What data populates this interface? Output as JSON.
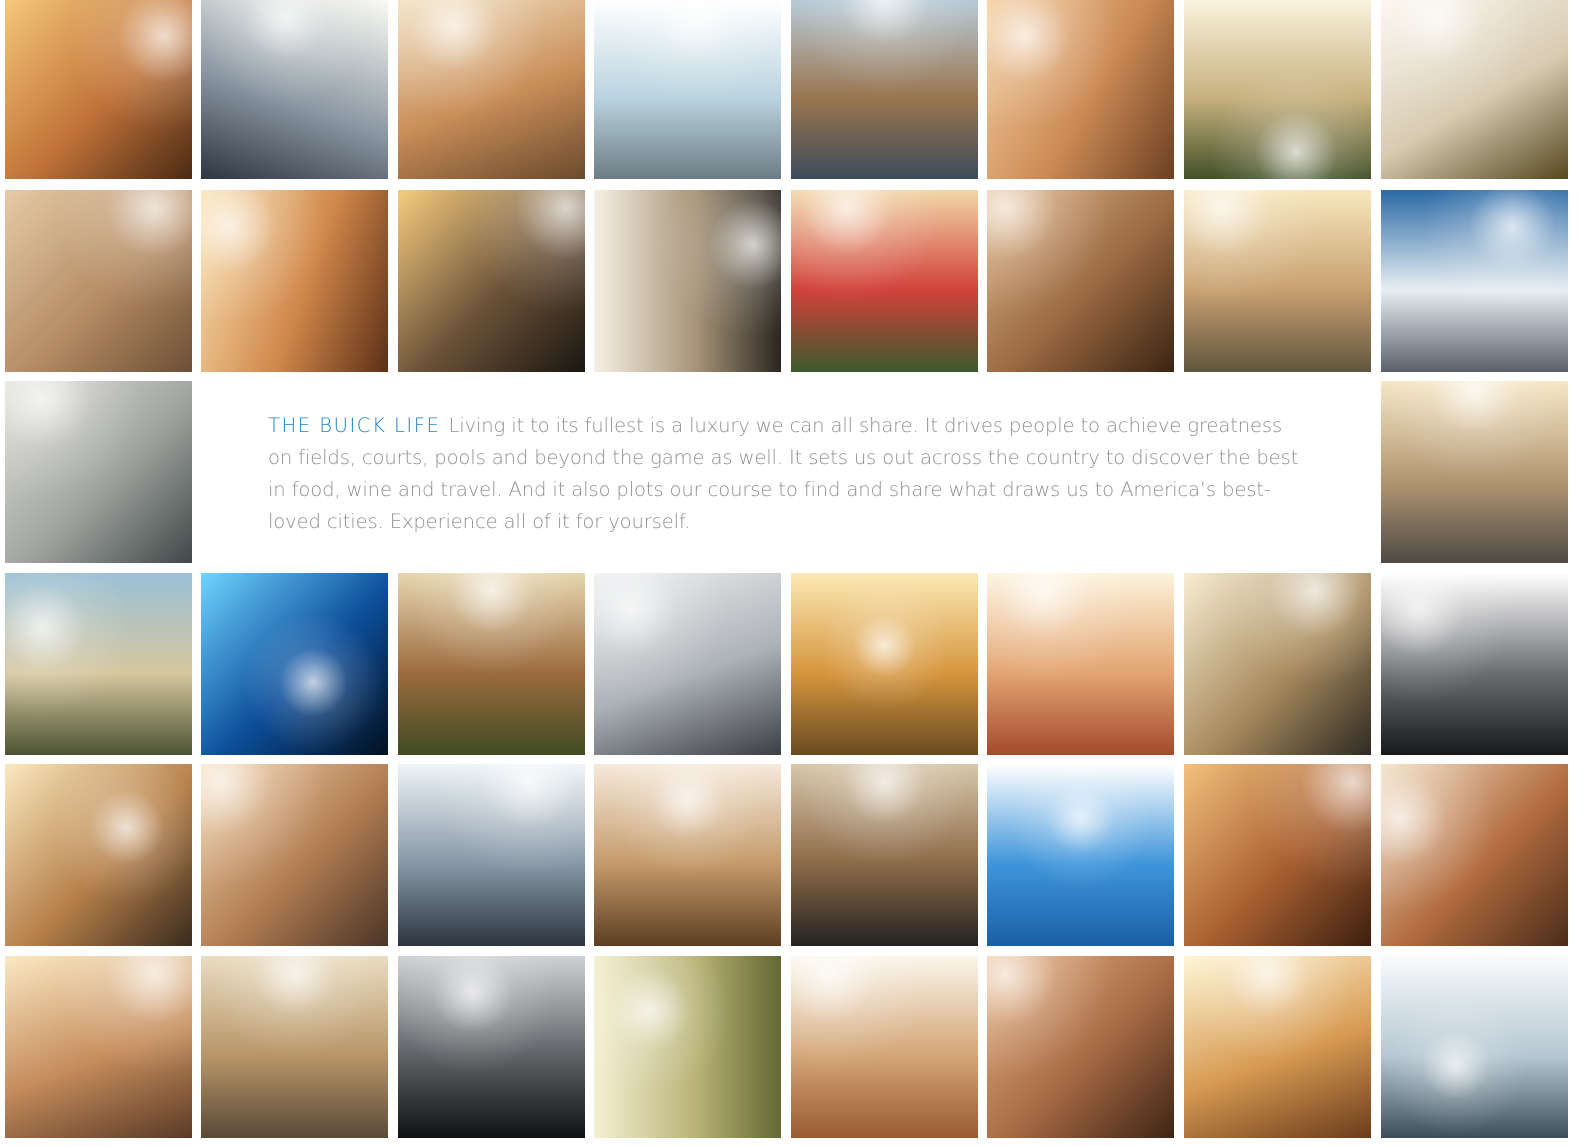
{
  "intro": {
    "heading": "THE BUICK LIFE",
    "body": "Living it to its fullest is a luxury we can all share. It drives people to achieve greatness on fields, courts, pools and beyond the game as well. It sets us out across the country to discover the best in food, wine and travel. And it also plots our course to find and share what draws us to America’s best-loved cities. Experience all of it for yourself.",
    "heading_color": "#1a83c6",
    "body_color": "#8f8f8f"
  },
  "photos": [
    {
      "name": "photo-woman-smiling-in-car",
      "row": 0,
      "col": 0,
      "colors": [
        "#f6c77a",
        "#c07238",
        "#4a2a14"
      ],
      "angle": 135,
      "sun": [
        0.85,
        0.2
      ]
    },
    {
      "name": "photo-car-trunk-sunburst",
      "row": 0,
      "col": 1,
      "colors": [
        "#fbfbf4",
        "#8c98a4",
        "#2d3640"
      ],
      "angle": 200,
      "sun": [
        0.45,
        0.1
      ]
    },
    {
      "name": "photo-couple-sitting-by-car",
      "row": 0,
      "col": 2,
      "colors": [
        "#f3e3c4",
        "#c98d58",
        "#6b4a2e"
      ],
      "angle": 160,
      "sun": [
        0.3,
        0.15
      ]
    },
    {
      "name": "photo-woman-walking-sunlight",
      "row": 0,
      "col": 3,
      "colors": [
        "#ffffff",
        "#b9d3df",
        "#6c7c84"
      ],
      "angle": 180,
      "sun": [
        0.55,
        0.1
      ]
    },
    {
      "name": "photo-city-skyline-waterfront",
      "row": 0,
      "col": 4,
      "colors": [
        "#b7cad8",
        "#9a7550",
        "#3d4b5c"
      ],
      "angle": 180,
      "sun": [
        0.5,
        0.0
      ]
    },
    {
      "name": "photo-woman-smiling-portrait",
      "row": 0,
      "col": 5,
      "colors": [
        "#f4d0a2",
        "#cc8a55",
        "#6b3f22"
      ],
      "angle": 120,
      "sun": [
        0.2,
        0.2
      ]
    },
    {
      "name": "photo-golfer-swinging",
      "row": 0,
      "col": 6,
      "colors": [
        "#fbf3dd",
        "#c7b07e",
        "#415028"
      ],
      "angle": 180,
      "sun": [
        0.6,
        0.85
      ]
    },
    {
      "name": "photo-plated-mussels-dish",
      "row": 0,
      "col": 7,
      "colors": [
        "#fbf7ef",
        "#d8cbb2",
        "#55481f"
      ],
      "angle": 150,
      "sun": [
        0.3,
        0.1
      ]
    },
    {
      "name": "photo-sandy-foot",
      "row": 1,
      "col": 0,
      "colors": [
        "#e5cba6",
        "#b58c65",
        "#6d4e35"
      ],
      "angle": 135,
      "sun": [
        0.8,
        0.1
      ]
    },
    {
      "name": "photo-woman-laughing-driving",
      "row": 1,
      "col": 1,
      "colors": [
        "#fbe4b4",
        "#d0874a",
        "#5c2f16"
      ],
      "angle": 110,
      "sun": [
        0.15,
        0.2
      ]
    },
    {
      "name": "photo-buick-grille-emblem",
      "row": 1,
      "col": 2,
      "colors": [
        "#f7cd7e",
        "#6b5238",
        "#1b1612"
      ],
      "angle": 135,
      "sun": [
        0.9,
        0.1
      ]
    },
    {
      "name": "photo-car-road-overhead",
      "row": 1,
      "col": 3,
      "colors": [
        "#f6f0e3",
        "#a69378",
        "#2a2620"
      ],
      "angle": 90,
      "sun": [
        0.85,
        0.3
      ]
    },
    {
      "name": "photo-girl-watermelon",
      "row": 1,
      "col": 4,
      "colors": [
        "#f2d7a8",
        "#d2413b",
        "#3b5a2c"
      ],
      "angle": 180,
      "sun": [
        0.3,
        0.1
      ]
    },
    {
      "name": "photo-man-smiling-portrait",
      "row": 1,
      "col": 5,
      "colors": [
        "#e2b98c",
        "#9a6841",
        "#3a2414"
      ],
      "angle": 135,
      "sun": [
        0.1,
        0.1
      ]
    },
    {
      "name": "photo-couple-walking-holding-hands",
      "row": 1,
      "col": 6,
      "colors": [
        "#f7e7bd",
        "#c8a070",
        "#61553e"
      ],
      "angle": 180,
      "sun": [
        0.2,
        0.1
      ]
    },
    {
      "name": "photo-snowy-mountains",
      "row": 1,
      "col": 7,
      "colors": [
        "#2b6aa6",
        "#e8eef2",
        "#5a606a"
      ],
      "angle": 180,
      "sun": [
        0.7,
        0.2
      ]
    },
    {
      "name": "photo-shadow-on-pebbles",
      "row": 2,
      "col": 0,
      "colors": [
        "#e2e1da",
        "#9fa39f",
        "#3f4848"
      ],
      "angle": 135,
      "sun": [
        0.2,
        0.1
      ]
    },
    {
      "name": "photo-car-mountain-road",
      "row": 2,
      "col": 7,
      "colors": [
        "#f6e7c6",
        "#b29672",
        "#4e4a44"
      ],
      "angle": 180,
      "sun": [
        0.5,
        0.05
      ]
    },
    {
      "name": "photo-coastal-cliffs",
      "row": 3,
      "col": 0,
      "colors": [
        "#9ac0d6",
        "#d6c79f",
        "#4c5332"
      ],
      "angle": 180,
      "sun": [
        0.2,
        0.3
      ]
    },
    {
      "name": "photo-blue-speedometer",
      "row": 3,
      "col": 1,
      "colors": [
        "#6fd4ff",
        "#0c4d9a",
        "#03101f"
      ],
      "angle": 135,
      "sun": [
        0.6,
        0.6
      ]
    },
    {
      "name": "photo-open-book-field",
      "row": 3,
      "col": 2,
      "colors": [
        "#e7d6b0",
        "#9c6b3e",
        "#3f4a22"
      ],
      "angle": 180,
      "sun": [
        0.5,
        0.1
      ]
    },
    {
      "name": "photo-silver-car-wheel",
      "row": 3,
      "col": 3,
      "colors": [
        "#f0f1f2",
        "#adb2b7",
        "#3b3f44"
      ],
      "angle": 160,
      "sun": [
        0.2,
        0.2
      ]
    },
    {
      "name": "photo-hikers-sunset",
      "row": 3,
      "col": 4,
      "colors": [
        "#fce9b6",
        "#d6963e",
        "#6a4a21"
      ],
      "angle": 180,
      "sun": [
        0.5,
        0.4
      ]
    },
    {
      "name": "photo-girl-eating-watermelon",
      "row": 3,
      "col": 5,
      "colors": [
        "#fdf3dc",
        "#e3a472",
        "#a44a2c"
      ],
      "angle": 180,
      "sun": [
        0.3,
        0.1
      ]
    },
    {
      "name": "photo-clothespins-line",
      "row": 3,
      "col": 6,
      "colors": [
        "#f8eed4",
        "#a88a5d",
        "#2e2a22"
      ],
      "angle": 135,
      "sun": [
        0.7,
        0.1
      ]
    },
    {
      "name": "photo-leather-seat",
      "row": 3,
      "col": 7,
      "colors": [
        "#ffffff",
        "#6b6d70",
        "#17181a"
      ],
      "angle": 180,
      "sun": [
        0.2,
        0.2
      ]
    },
    {
      "name": "photo-car-under-bridge",
      "row": 4,
      "col": 0,
      "colors": [
        "#fbe9bf",
        "#b6804a",
        "#3a2a1d"
      ],
      "angle": 135,
      "sun": [
        0.65,
        0.35
      ]
    },
    {
      "name": "photo-couple-in-car",
      "row": 4,
      "col": 1,
      "colors": [
        "#f4d9b3",
        "#b27c52",
        "#4a3526"
      ],
      "angle": 135,
      "sun": [
        0.1,
        0.1
      ]
    },
    {
      "name": "photo-car-wind-turbines",
      "row": 4,
      "col": 2,
      "colors": [
        "#eef4f8",
        "#8797a6",
        "#2c3540"
      ],
      "angle": 180,
      "sun": [
        0.7,
        0.1
      ]
    },
    {
      "name": "photo-winding-road",
      "row": 4,
      "col": 3,
      "colors": [
        "#f6eadb",
        "#c49a6a",
        "#5d3e22"
      ],
      "angle": 180,
      "sun": [
        0.5,
        0.2
      ]
    },
    {
      "name": "photo-car-dashboard",
      "row": 4,
      "col": 4,
      "colors": [
        "#d8c7ab",
        "#8c6a48",
        "#242222"
      ],
      "angle": 180,
      "sun": [
        0.5,
        0.1
      ]
    },
    {
      "name": "photo-sun-blue-sky",
      "row": 4,
      "col": 5,
      "colors": [
        "#ffffff",
        "#3e95db",
        "#1a5fa7"
      ],
      "angle": 180,
      "sun": [
        0.5,
        0.3
      ]
    },
    {
      "name": "photo-man-smiling-sunlit",
      "row": 4,
      "col": 6,
      "colors": [
        "#f4c17c",
        "#a85f30",
        "#3b1f10"
      ],
      "angle": 135,
      "sun": [
        0.9,
        0.1
      ]
    },
    {
      "name": "photo-woman-red-hair-car",
      "row": 4,
      "col": 7,
      "colors": [
        "#f3e2c8",
        "#b26b3e",
        "#4a2c1a"
      ],
      "angle": 135,
      "sun": [
        0.1,
        0.3
      ]
    },
    {
      "name": "photo-woman-relaxing-seat",
      "row": 5,
      "col": 0,
      "colors": [
        "#fbe8c3",
        "#c58c5c",
        "#5a3a26"
      ],
      "angle": 160,
      "sun": [
        0.8,
        0.1
      ]
    },
    {
      "name": "photo-car-desert-dunes",
      "row": 5,
      "col": 1,
      "colors": [
        "#e9dcc1",
        "#b89568",
        "#5a4a38"
      ],
      "angle": 180,
      "sun": [
        0.5,
        0.1
      ]
    },
    {
      "name": "photo-gear-shifter",
      "row": 5,
      "col": 2,
      "colors": [
        "#cfd2d5",
        "#5f6166",
        "#101113"
      ],
      "angle": 180,
      "sun": [
        0.4,
        0.2
      ]
    },
    {
      "name": "photo-motion-blur-trees",
      "row": 5,
      "col": 3,
      "colors": [
        "#f5f0d2",
        "#b8b276",
        "#626832"
      ],
      "angle": 90,
      "sun": [
        0.3,
        0.3
      ]
    },
    {
      "name": "photo-skyscraper-sunset",
      "row": 5,
      "col": 4,
      "colors": [
        "#fbf6ec",
        "#d3a576",
        "#9a5a32"
      ],
      "angle": 180,
      "sun": [
        0.2,
        0.1
      ]
    },
    {
      "name": "photo-man-laughing-closeup",
      "row": 5,
      "col": 5,
      "colors": [
        "#e8b889",
        "#a76944",
        "#3d2415"
      ],
      "angle": 135,
      "sun": [
        0.1,
        0.1
      ]
    },
    {
      "name": "photo-woman-sun-flare",
      "row": 5,
      "col": 6,
      "colors": [
        "#fff6d6",
        "#d79a52",
        "#6b3c1c"
      ],
      "angle": 160,
      "sun": [
        0.45,
        0.1
      ]
    },
    {
      "name": "photo-water-droplet-ripple",
      "row": 5,
      "col": 7,
      "colors": [
        "#f9fbfc",
        "#b5c7d2",
        "#3b4e5a"
      ],
      "angle": 180,
      "sun": [
        0.4,
        0.6
      ]
    }
  ]
}
